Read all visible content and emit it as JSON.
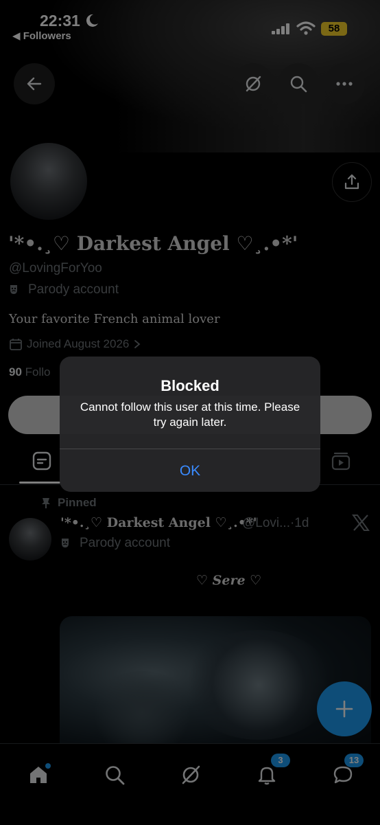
{
  "status_bar": {
    "time": "22:31",
    "back_app": "◀ Followers",
    "battery": "58"
  },
  "header": {
    "back_icon": "arrow-left-icon",
    "grok_icon": "grok-icon",
    "search_icon": "search-icon",
    "more_icon": "more-horizontal-icon"
  },
  "profile": {
    "display_name": "'*•.¸♡ Darkest Angel ♡¸.•*'",
    "handle": "@LovingForYoo",
    "parody_label": "Parody account",
    "bio": "Your favorite French animal lover",
    "joined": "Joined August 2026",
    "following_count": "90",
    "following_label_partial": "Follo"
  },
  "alert": {
    "title": "Blocked",
    "message": "Cannot follow this user at this time. Please try again later.",
    "ok_label": "OK",
    "accent": "#3a8bff"
  },
  "pinned_post": {
    "pinned_label": "Pinned",
    "author_name": "'*•.¸♡ Darkest Angel ♡¸.•*'",
    "author_handle_time": "@Lovi...·1d",
    "parody_label": "Parody account",
    "text": "♡ Sere ♡"
  },
  "bottom_nav": {
    "notifications_badge": "3",
    "messages_badge": "13"
  },
  "colors": {
    "accent": "#1d9bf0",
    "background": "#000000",
    "muted_text": "#71767b"
  }
}
